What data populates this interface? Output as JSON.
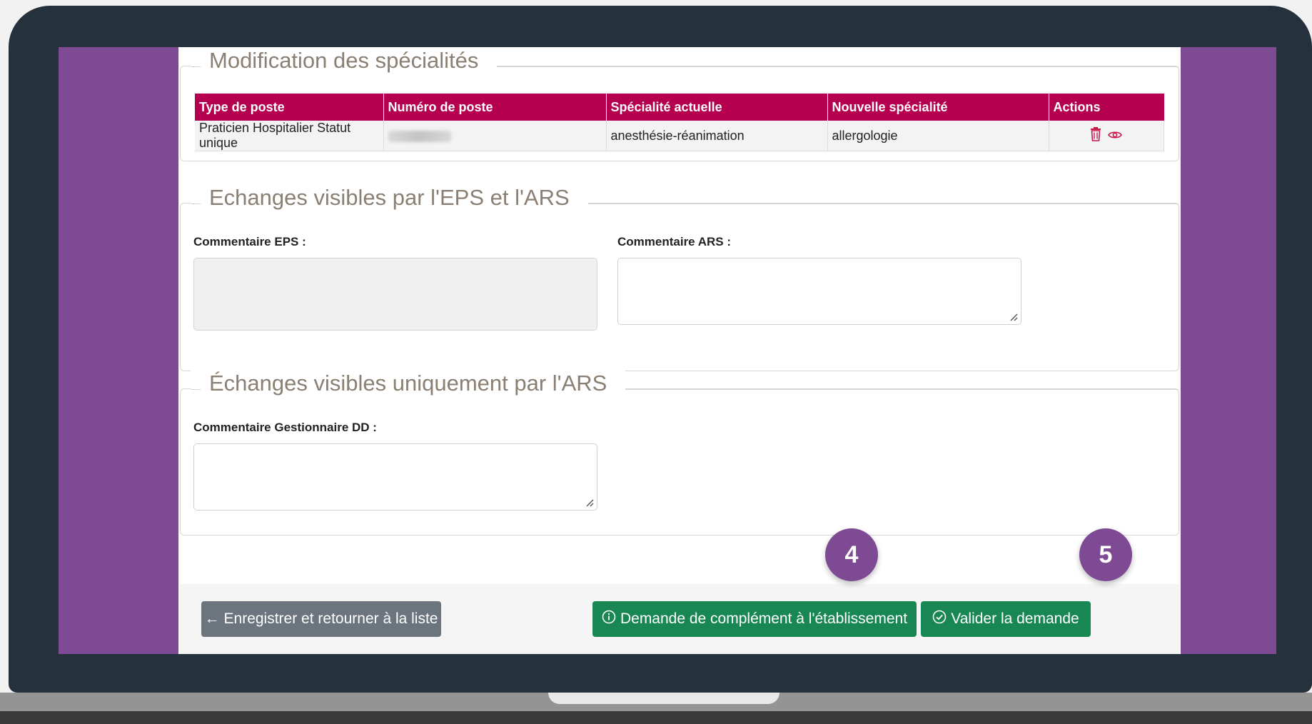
{
  "specialties_section": {
    "legend": "Modification des spécialités",
    "columns": [
      "Type de poste",
      "Numéro de poste",
      "Spécialité actuelle",
      "Nouvelle spécialité",
      "Actions"
    ],
    "rows": [
      {
        "type_de_poste": "Praticien Hospitalier Statut unique",
        "specialite_actuelle": "anesthésie-réanimation",
        "nouvelle_specialite": "allergologie"
      }
    ]
  },
  "exchanges_eps_ars": {
    "legend": "Echanges visibles par l'EPS et l'ARS",
    "comment_eps_label": "Commentaire EPS :",
    "comment_ars_label": "Commentaire ARS :"
  },
  "exchanges_ars_only": {
    "legend": "Échanges visibles uniquement par l'ARS",
    "comment_dd_label": "Commentaire Gestionnaire DD :"
  },
  "footer": {
    "back_button": "Enregistrer et retourner à la liste",
    "request_complement_button": "Demande de complément à l'établissement",
    "validate_button": "Valider la demande"
  },
  "callouts": {
    "step_4": "4",
    "step_5": "5"
  },
  "colors": {
    "table_header": "#b5004f",
    "primary_green": "#198754",
    "secondary_grey": "#6c757d",
    "callout_purple": "#7e4a94"
  }
}
